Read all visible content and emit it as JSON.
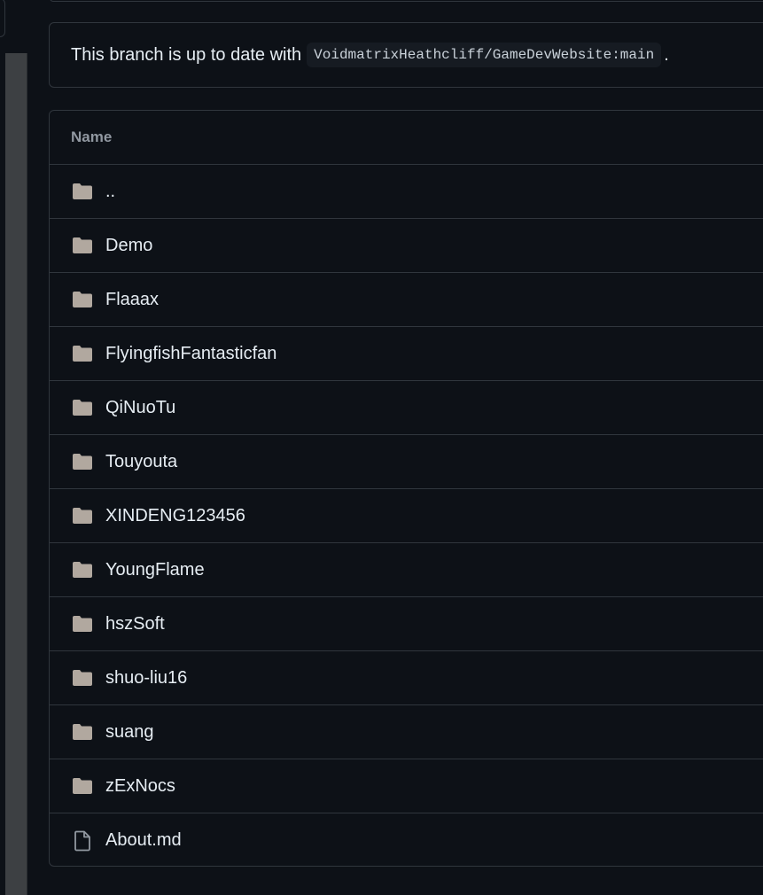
{
  "branch_status": {
    "text": "This branch is up to date with",
    "ref": "VoidmatrixHeathcliff/GameDevWebsite:main",
    "suffix": "."
  },
  "table": {
    "header": "Name",
    "rows": [
      {
        "name": "..",
        "type": "folder"
      },
      {
        "name": "Demo",
        "type": "folder"
      },
      {
        "name": "Flaaax",
        "type": "folder"
      },
      {
        "name": "FlyingfishFantasticfan",
        "type": "folder"
      },
      {
        "name": "QiNuoTu",
        "type": "folder"
      },
      {
        "name": "Touyouta",
        "type": "folder"
      },
      {
        "name": "XINDENG123456",
        "type": "folder"
      },
      {
        "name": "YoungFlame",
        "type": "folder"
      },
      {
        "name": "hszSoft",
        "type": "folder"
      },
      {
        "name": "shuo-liu16",
        "type": "folder"
      },
      {
        "name": "suang",
        "type": "folder"
      },
      {
        "name": "zExNocs",
        "type": "folder"
      },
      {
        "name": "About.md",
        "type": "file"
      }
    ]
  },
  "colors": {
    "background": "#0d1117",
    "border": "#30363d",
    "folder_icon": "#b1a89f",
    "file_icon": "#9198a1"
  }
}
